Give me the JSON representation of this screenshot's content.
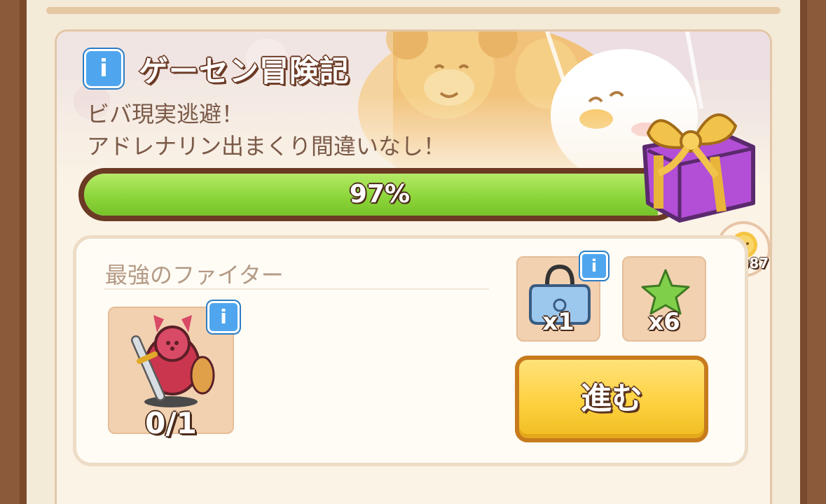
{
  "event": {
    "title": "ゲーセン冒険記",
    "description_line1": "ビバ現実逃避！",
    "description_line2": "アドレナリン出まくり間違いなし！",
    "info_icon_glyph": "i"
  },
  "progress": {
    "label": "97%",
    "value": 0.97
  },
  "reward_chest": {
    "icon": "gift-box-icon"
  },
  "currency": {
    "icon": "sun-coin-icon",
    "count_label": "x1087"
  },
  "task": {
    "title": "最強のファイター",
    "requirement": {
      "icon": "red-knight-figure-icon",
      "count_label": "0/1"
    }
  },
  "rewards": [
    {
      "icon": "blue-bag-icon",
      "count_label": "x1"
    },
    {
      "icon": "green-star-icon",
      "count_label": "x6"
    }
  ],
  "buttons": {
    "proceed_label": "進む"
  },
  "colors": {
    "frame_brown": "#7a4a2c",
    "progress_green": "#8ad438",
    "button_yellow": "#fdd13f",
    "info_blue": "#4fa6ee"
  }
}
